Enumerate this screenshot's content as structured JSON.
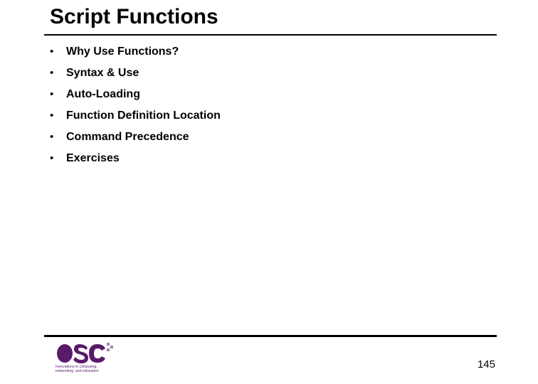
{
  "title": "Script Functions",
  "bullets": [
    "Why Use Functions?",
    "Syntax & Use",
    "Auto-Loading",
    "Function Definition Location",
    "Command Precedence",
    "Exercises"
  ],
  "logo": {
    "letters": "OSC",
    "color": "#5a1a6a",
    "tagline1": "Innovations in computing,",
    "tagline2": "networking, and education"
  },
  "page_number": "145"
}
